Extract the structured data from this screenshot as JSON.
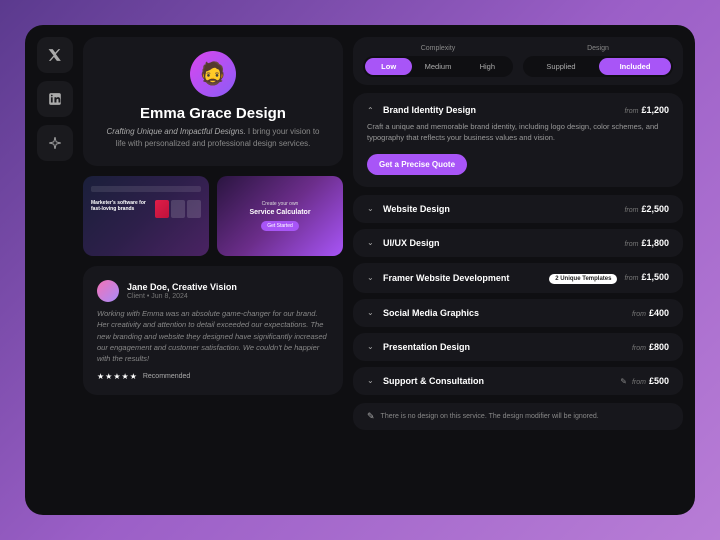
{
  "social": {
    "x": "x-icon",
    "linkedin": "linkedin-icon",
    "spark": "spark-icon"
  },
  "profile": {
    "name": "Emma Grace Design",
    "bio_italic": "Crafting Unique and Impactful Designs.",
    "bio_rest": " I bring your vision to life with personalized and professional design services."
  },
  "thumbs": {
    "t1_line": "Marketer's software for fast-loving brands",
    "t2_pre": "Create your own",
    "t2_title": "Service Calculator",
    "t2_btn": "Get Started"
  },
  "testimonial": {
    "name": "Jane Doe, Creative Vision",
    "meta": "Client • Jun 8, 2024",
    "quote": "Working with Emma was an absolute game-changer for our brand. Her creativity and attention to detail exceeded our expectations. The new branding and website they designed have significantly increased our engagement and customer satisfaction. We couldn't be happier with the results!",
    "stars": "★★★★★",
    "rec": "Recommended"
  },
  "filters": {
    "complexity_label": "Complexity",
    "design_label": "Design",
    "complexity": [
      "Low",
      "Medium",
      "High"
    ],
    "design": [
      "Supplied",
      "Included"
    ]
  },
  "featured": {
    "title": "Brand Identity Design",
    "from": "from",
    "price": "£1,200",
    "desc": "Craft a unique and memorable brand identity, including logo design, color schemes, and typography that reflects your business values and vision.",
    "cta": "Get a Precise Quote"
  },
  "services": [
    {
      "title": "Website Design",
      "from": "from",
      "price": "£2,500"
    },
    {
      "title": "UI/UX Design",
      "from": "from",
      "price": "£1,800"
    },
    {
      "title": "Framer Website Development",
      "badge": "2 Unique Templates",
      "from": "from",
      "price": "£1,500"
    },
    {
      "title": "Social Media Graphics",
      "from": "from",
      "price": "£400"
    },
    {
      "title": "Presentation Design",
      "from": "from",
      "price": "£800"
    },
    {
      "title": "Support & Consultation",
      "no_design": true,
      "from": "from",
      "price": "£500"
    }
  ],
  "notice": "There is no design on this service. The design modifier will be ignored."
}
